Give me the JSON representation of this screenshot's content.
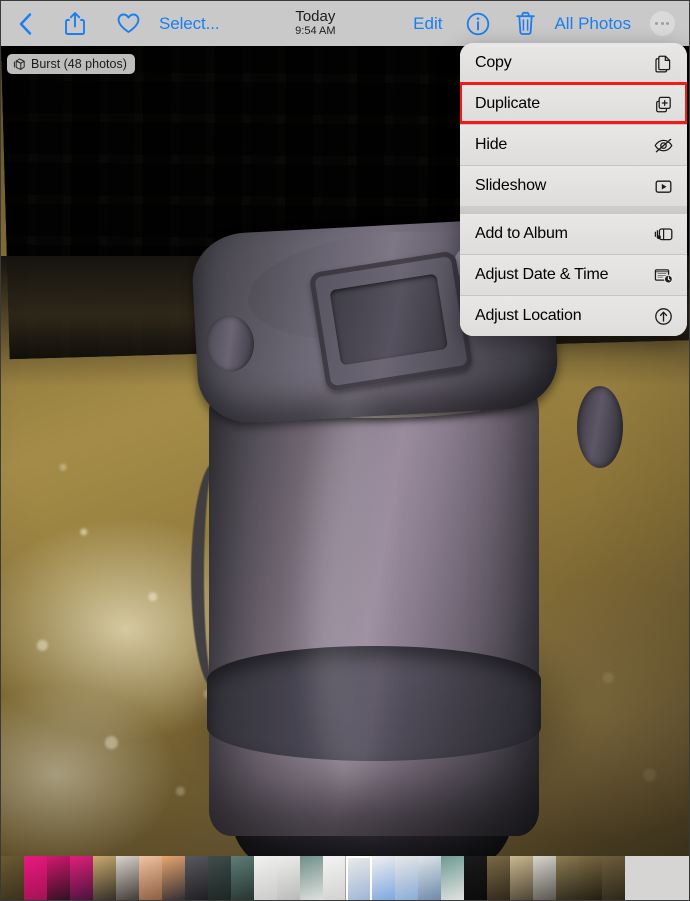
{
  "app": "photos-viewer",
  "toolbar": {
    "back_icon": "chevron-left-icon",
    "share_icon": "share-icon",
    "favorite_icon": "heart-icon",
    "select_label": "Select...",
    "title": "Today",
    "subtitle": "9:54 AM",
    "edit_label": "Edit",
    "info_icon": "info-circle-icon",
    "delete_icon": "trash-icon",
    "all_photos_label": "All Photos",
    "more_icon": "ellipsis-circle-icon",
    "tint_color": "#1a7ef0",
    "background_color": "#c9c9c9"
  },
  "photo": {
    "burst_badge": "Burst (48 photos)",
    "burst_icon": "burst-stack-icon"
  },
  "menu": {
    "highlight_color": "#f41a17",
    "highlighted_item": "Duplicate",
    "background_color": "#e4e3e1",
    "groups": [
      {
        "items": [
          {
            "label": "Copy",
            "icon": "copy-icon"
          },
          {
            "label": "Duplicate",
            "icon": "duplicate-icon"
          },
          {
            "label": "Hide",
            "icon": "eye-slash-icon"
          },
          {
            "label": "Slideshow",
            "icon": "play-rectangle-icon"
          }
        ]
      },
      {
        "items": [
          {
            "label": "Add to Album",
            "icon": "album-icon"
          },
          {
            "label": "Adjust Date & Time",
            "icon": "calendar-clock-icon"
          },
          {
            "label": "Adjust Location",
            "icon": "location-arrow-circle-icon"
          }
        ]
      }
    ]
  },
  "filmstrip": {
    "selected_index": 15,
    "thumbnails": [
      {
        "id": "t0",
        "color": "linear-gradient(160deg,#6b5a33,#3a301a)"
      },
      {
        "id": "t1",
        "color": "linear-gradient(160deg,#e8197f,#a01254)"
      },
      {
        "id": "t2",
        "color": "linear-gradient(160deg,#d4186f,#2a1020)"
      },
      {
        "id": "t3",
        "color": "linear-gradient(160deg,#e0207a,#45123a)"
      },
      {
        "id": "t4",
        "color": "linear-gradient(160deg,#caa96e,#2e2a24)"
      },
      {
        "id": "t5",
        "color": "linear-gradient(160deg,#d9d4cc,#3b3630)"
      },
      {
        "id": "t6",
        "color": "linear-gradient(160deg,#f0c3a2,#8a5a3c)"
      },
      {
        "id": "t7",
        "color": "linear-gradient(160deg,#e9a66f,#2b2a30)"
      },
      {
        "id": "t8",
        "color": "linear-gradient(160deg,#5a595f,#1d1c20)"
      },
      {
        "id": "t9",
        "color": "linear-gradient(160deg,#3f4d4a,#1b2422)"
      },
      {
        "id": "t10",
        "color": "linear-gradient(160deg,#5e7d76,#24322f)"
      },
      {
        "id": "t11",
        "color": "linear-gradient(160deg,#f2f2f0,#c9c9c7)"
      },
      {
        "id": "t12",
        "color": "linear-gradient(160deg,#eeeeec,#b8b8b6)"
      },
      {
        "id": "t13",
        "color": "linear-gradient(160deg,#6f8f88,#e4e4e2)"
      },
      {
        "id": "t14",
        "color": "linear-gradient(160deg,#f4f4f2,#d0d0ce)"
      },
      {
        "id": "t15",
        "color": "linear-gradient(160deg,#eaeae8,#9fb5d8)"
      },
      {
        "id": "t16",
        "color": "linear-gradient(160deg,#f1f1ef,#7aa4dd)"
      },
      {
        "id": "t17",
        "color": "linear-gradient(160deg,#e9e9e7,#86a9d6)"
      },
      {
        "id": "t18",
        "color": "linear-gradient(160deg,#dfe6ea,#6a86a8)"
      },
      {
        "id": "t19",
        "color": "linear-gradient(160deg,#6f9a92,#e6e6e4)"
      },
      {
        "id": "t20",
        "color": "linear-gradient(160deg,#1a1a1a,#0a0a0a)"
      },
      {
        "id": "t21",
        "color": "linear-gradient(160deg,#7a6a46,#2b2418)"
      },
      {
        "id": "t22",
        "color": "linear-gradient(160deg,#c9b98e,#4a4032)"
      },
      {
        "id": "t23",
        "color": "linear-gradient(160deg,#d8d6cf,#55504a)"
      },
      {
        "id": "t24",
        "color": "linear-gradient(160deg,#8b7c52,#2a2418)"
      },
      {
        "id": "t25",
        "color": "linear-gradient(160deg,#7b6a42,#1f1a10)"
      },
      {
        "id": "t26",
        "color": "linear-gradient(160deg,#6e5f3c,#2a2418)"
      }
    ]
  }
}
